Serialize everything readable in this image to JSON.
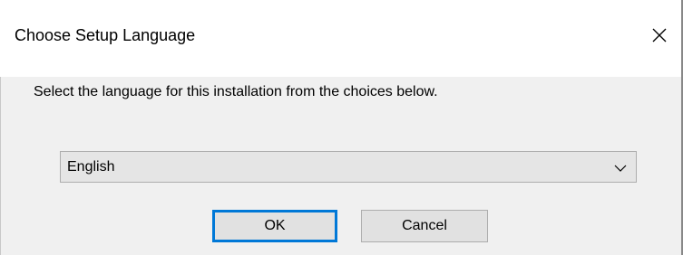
{
  "window": {
    "title": "Choose Setup Language",
    "close_icon": "close-icon"
  },
  "dialog": {
    "prompt": "Select the language for this installation from the choices below.",
    "language_select": {
      "selected": "English",
      "arrow_icon": "chevron-down-icon"
    },
    "buttons": {
      "ok_label": "OK",
      "cancel_label": "Cancel"
    }
  },
  "colors": {
    "titlebar": "#ffffff",
    "body": "#f0f0f0",
    "focus_accent": "#0078d7",
    "button_face": "#e1e1e1"
  }
}
